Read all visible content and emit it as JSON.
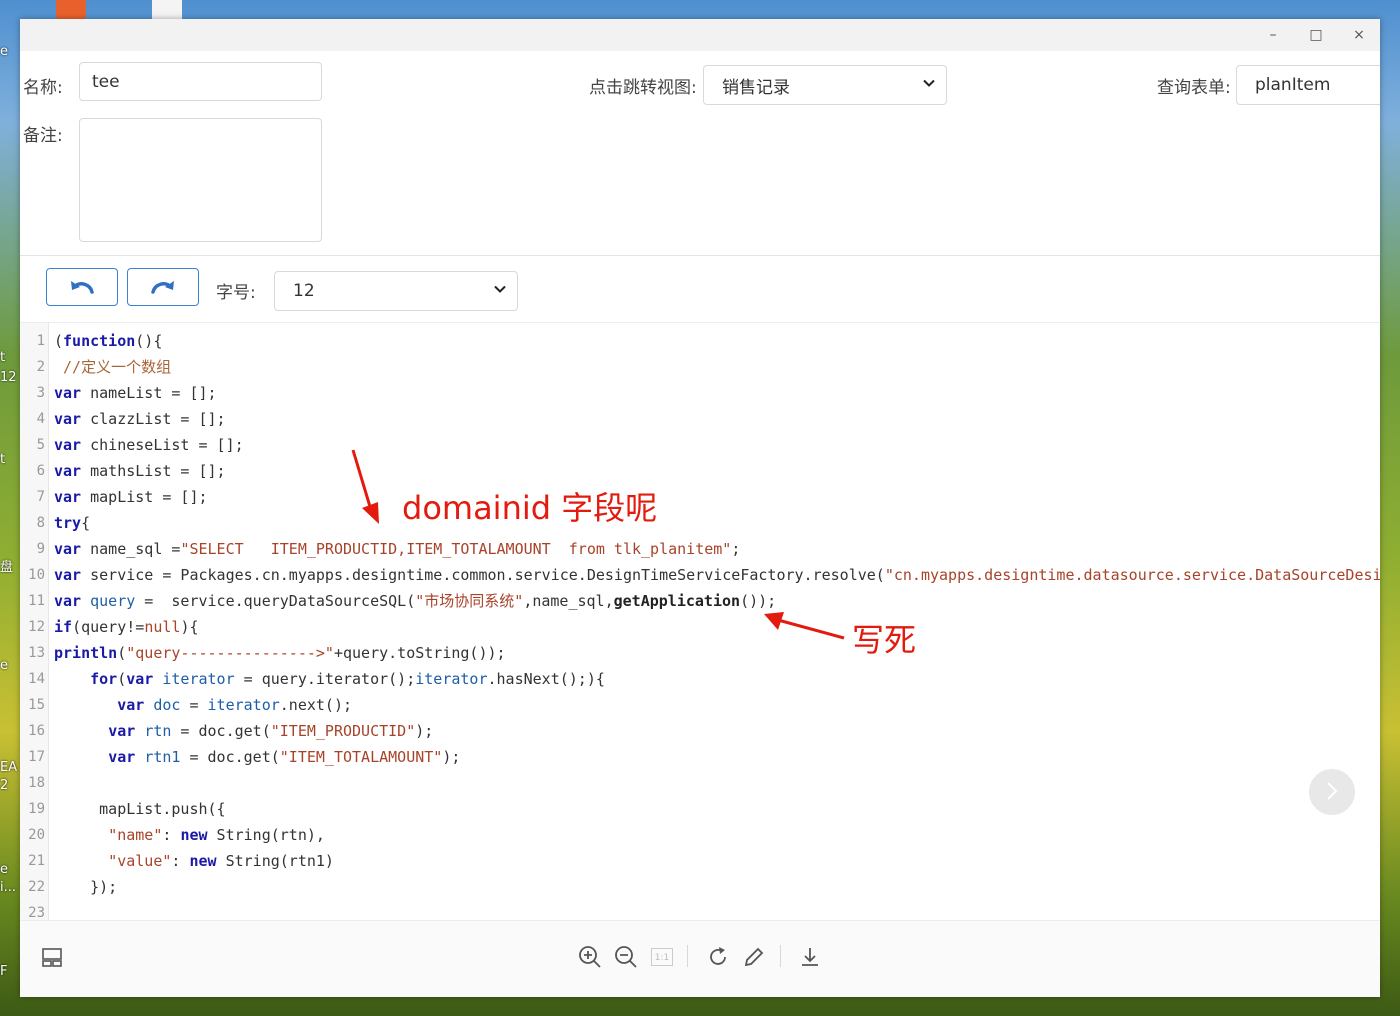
{
  "desktop": {
    "left_edge_texts": [
      "e",
      "t",
      "12",
      "t",
      "盘",
      "e",
      "EA",
      "2",
      "e",
      "i...",
      "F"
    ]
  },
  "window": {
    "controls": {
      "minimize": "–",
      "maximize": "□",
      "close": "×"
    }
  },
  "form": {
    "name_label": "名称:",
    "name_value": "tee",
    "remark_label": "备注:",
    "remark_value": "",
    "jump_view_label": "点击跳转视图:",
    "jump_view_value": "销售记录",
    "query_form_label": "查询表单:",
    "query_form_value": "planItem"
  },
  "editor_toolbar": {
    "font_size_label": "字号:",
    "font_size_value": "12"
  },
  "code_lines": [
    "1",
    "2",
    "3",
    "4",
    "5",
    "6",
    "7",
    "8",
    "9",
    "10",
    "11",
    "12",
    "13",
    "14",
    "15",
    "16",
    "17",
    "18",
    "19",
    "20",
    "21",
    "22",
    "23"
  ],
  "code": {
    "l1": "(function(){",
    "l2": " //定义一个数组",
    "l3": "var nameList = [];",
    "l4": "var clazzList = [];",
    "l5": "var chineseList = [];",
    "l6": "var mathsList = [];",
    "l7": "var mapList = [];",
    "l8": "try{",
    "l9_a": "var name_sql =",
    "l9_b": "\"SELECT   ITEM_PRODUCTID,ITEM_TOTALAMOUNT  from tlk_planitem\"",
    "l9_c": ";",
    "l10_a": "var service = Packages.cn.myapps.designtime.common.service.DesignTimeServiceFactory.resolve(",
    "l10_b": "\"cn.myapps.designtime.datasource.service.DataSourceDesi",
    "l11_a": "var ",
    "l11_b": "query",
    "l11_c": " =  service.queryDataSourceSQL(",
    "l11_d": "\"市场协同系统\"",
    "l11_e": ",name_sql,",
    "l11_f": "getApplication",
    "l11_g": "());",
    "l12_a": "if(query!=",
    "l12_b": "null",
    "l12_c": "){",
    "l13_a": "println(",
    "l13_b": "\"query--------------->\"",
    "l13_c": "+query.toString());",
    "l14_a": "    for(",
    "l14_b": "var",
    "l14_c": "iterator",
    "l14_d": " = query.iterator();",
    "l14_e": "iterator",
    "l14_f": ".hasNext();){",
    "l15_a": "       var ",
    "l15_b": "doc",
    "l15_c": " = ",
    "l15_d": "iterator",
    "l15_e": ".next();",
    "l16_a": "      var ",
    "l16_b": "rtn",
    "l16_c": " = doc.get(",
    "l16_d": "\"ITEM_PRODUCTID\"",
    "l16_e": ");",
    "l17_a": "      var ",
    "l17_b": "rtn1",
    "l17_c": " = doc.get(",
    "l17_d": "\"ITEM_TOTALAMOUNT\"",
    "l17_e": ");",
    "l18": "",
    "l19": "     mapList.push({",
    "l20_a": "      ",
    "l20_b": "\"name\"",
    "l20_c": ": ",
    "l20_d": "new",
    "l20_e": " String(rtn),",
    "l21_a": "      ",
    "l21_b": "\"value\"",
    "l21_c": ": ",
    "l21_d": "new",
    "l21_e": " String(rtn1)",
    "l22": "    });",
    "l23": ""
  },
  "annotations": {
    "domainid": "domainid 字段呢",
    "hardcoded": "写死"
  },
  "colors": {
    "annotation_red": "#e31b0e",
    "keyword_blue": "#1a1aa6",
    "string_brown": "#a8432a",
    "button_blue": "#3b82d6"
  },
  "icons": {
    "undo": "undo-icon",
    "redo": "redo-icon",
    "next": "chevron-right-icon",
    "layout": "layout-icon",
    "zoom_in": "zoom-in-icon",
    "zoom_out": "zoom-out-icon",
    "actual_size": "actual-size-icon",
    "rotate": "rotate-icon",
    "edit": "pencil-icon",
    "download": "download-icon"
  },
  "bottom_toolbar": {
    "actual_size_text": "1:1"
  }
}
